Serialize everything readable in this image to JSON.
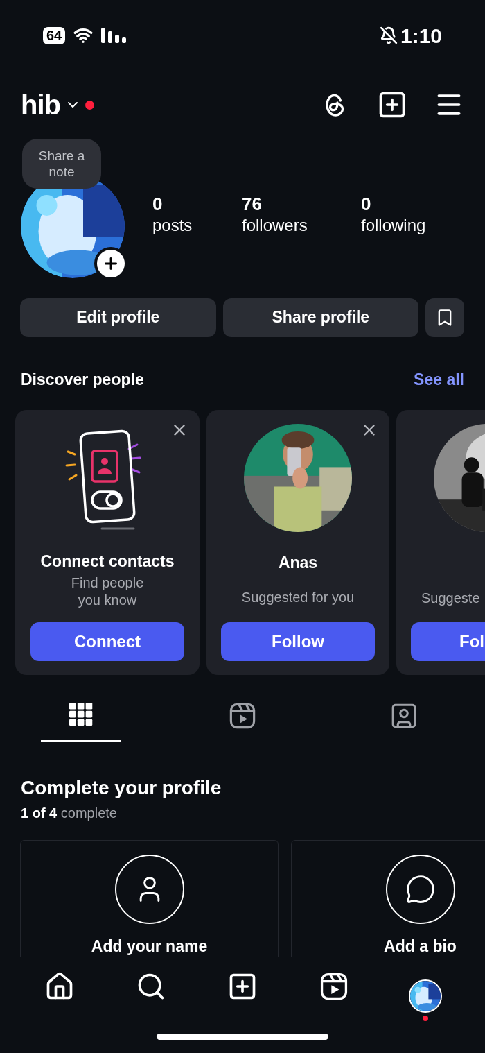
{
  "status_bar": {
    "battery": "64",
    "time": "1:10"
  },
  "header": {
    "username": "hib",
    "notification_dot": true
  },
  "profile": {
    "note": "Share a note",
    "stats": [
      {
        "value": "0",
        "label": "posts"
      },
      {
        "value": "76",
        "label": "followers"
      },
      {
        "value": "0",
        "label": "following"
      }
    ]
  },
  "actions": [
    "Edit profile",
    "Share profile"
  ],
  "discover": {
    "title": "Discover people",
    "see_all": "See all",
    "cards": [
      {
        "kind": "contacts",
        "title": "Connect contacts",
        "subtitle": "Find people you know",
        "button": "Connect",
        "dismissible": true
      },
      {
        "kind": "person",
        "title": "Anas",
        "subtitle": "Suggested for you",
        "button": "Follow",
        "dismissible": true
      },
      {
        "kind": "partial",
        "subtitle": "Suggeste",
        "button": "Fol"
      }
    ]
  },
  "tabs": [
    {
      "kind": "grid",
      "selected": true
    },
    {
      "kind": "reels",
      "selected": false
    },
    {
      "kind": "tagged",
      "selected": false
    }
  ],
  "complete": {
    "title": "Complete your profile",
    "progress": "**1 of 4** complete",
    "cards": [
      {
        "kind": "name",
        "label": "Add your name"
      },
      {
        "kind": "bio",
        "label": "Add a bio"
      }
    ]
  },
  "nav": [
    {
      "kind": "home"
    },
    {
      "kind": "search"
    },
    {
      "kind": "create"
    },
    {
      "kind": "reels"
    },
    {
      "kind": "profile",
      "notification_dot": true
    }
  ]
}
